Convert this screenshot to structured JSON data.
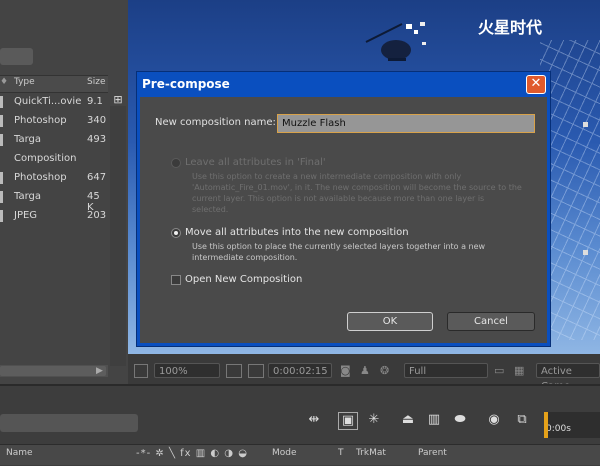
{
  "project": {
    "columns": {
      "type": "Type",
      "size": "Size"
    },
    "items": [
      {
        "type": "QuickTi...ovie",
        "size": "9.1"
      },
      {
        "type": "Photoshop",
        "size": "340"
      },
      {
        "type": "Targa",
        "size": "493"
      },
      {
        "type": "Composition",
        "size": ""
      },
      {
        "type": "Photoshop",
        "size": "647"
      },
      {
        "type": "Targa",
        "size": "45 K"
      },
      {
        "type": "JPEG",
        "size": "203"
      }
    ]
  },
  "viewer": {
    "logo": "火星时代",
    "zoom": "100%",
    "timecode": "0:00:02:15",
    "resolution": "Full",
    "camera": "Active Came"
  },
  "timeline": {
    "header": {
      "source_name": "Name",
      "mode": "Mode",
      "t": "T",
      "trkmat": "TrkMat",
      "parent": "Parent"
    },
    "ruler_time": "0:00s"
  },
  "dialog": {
    "title": "Pre-compose",
    "name_label": "New composition name:",
    "name_value": "Muzzle Flash",
    "option1_label": "Leave all attributes in 'Final'",
    "option1_desc": "Use this option to create a new intermediate composition with only 'Automatic_Fire_01.mov', in it. The new composition will become the source to the current layer. This option is not available because more than one layer is selected.",
    "option2_label": "Move all attributes into the new composition",
    "option2_desc": "Use this option to place the currently selected layers together into a new intermediate composition.",
    "open_label": "Open New Composition",
    "ok": "OK",
    "cancel": "Cancel"
  }
}
